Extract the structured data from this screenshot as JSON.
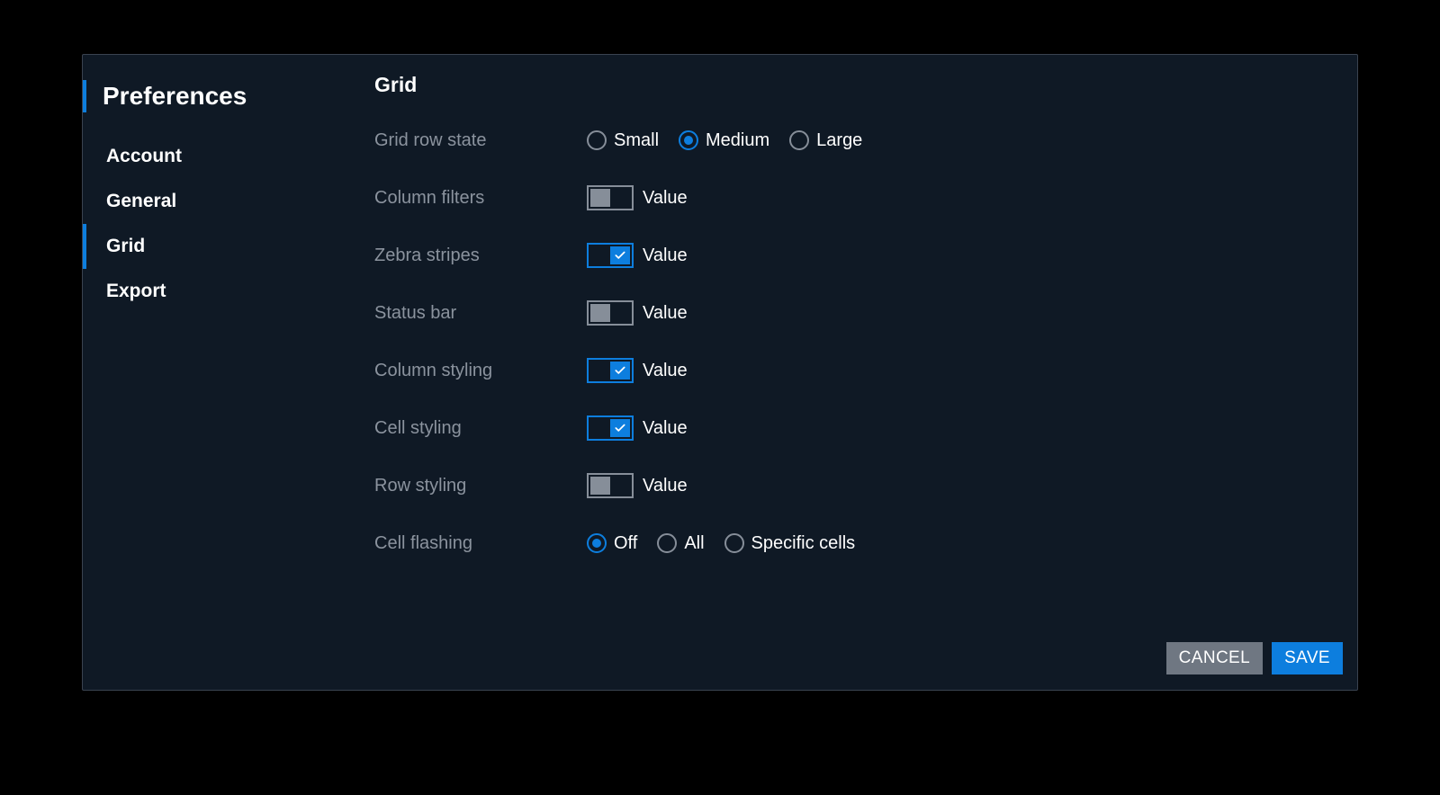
{
  "title": "Preferences",
  "nav": {
    "items": [
      {
        "label": "Account",
        "active": false
      },
      {
        "label": "General",
        "active": false
      },
      {
        "label": "Grid",
        "active": true
      },
      {
        "label": "Export",
        "active": false
      }
    ]
  },
  "section": {
    "title": "Grid",
    "rows": {
      "grid_row_state": {
        "label": "Grid row state",
        "type": "radio",
        "options": [
          {
            "label": "Small",
            "selected": false
          },
          {
            "label": "Medium",
            "selected": true
          },
          {
            "label": "Large",
            "selected": false
          }
        ]
      },
      "column_filters": {
        "label": "Column filters",
        "type": "toggle",
        "on": false,
        "value_label": "Value"
      },
      "zebra_stripes": {
        "label": "Zebra stripes",
        "type": "toggle",
        "on": true,
        "value_label": "Value"
      },
      "status_bar": {
        "label": "Status bar",
        "type": "toggle",
        "on": false,
        "value_label": "Value"
      },
      "column_styling": {
        "label": "Column styling",
        "type": "toggle",
        "on": true,
        "value_label": "Value"
      },
      "cell_styling": {
        "label": "Cell styling",
        "type": "toggle",
        "on": true,
        "value_label": "Value"
      },
      "row_styling": {
        "label": "Row styling",
        "type": "toggle",
        "on": false,
        "value_label": "Value"
      },
      "cell_flashing": {
        "label": "Cell flashing",
        "type": "radio",
        "options": [
          {
            "label": "Off",
            "selected": true
          },
          {
            "label": "All",
            "selected": false
          },
          {
            "label": "Specific cells",
            "selected": false
          }
        ]
      }
    }
  },
  "footer": {
    "cancel": "CANCEL",
    "save": "SAVE"
  },
  "colors": {
    "accent": "#0d7ede",
    "panel": "#0f1925",
    "muted": "#868e99"
  }
}
